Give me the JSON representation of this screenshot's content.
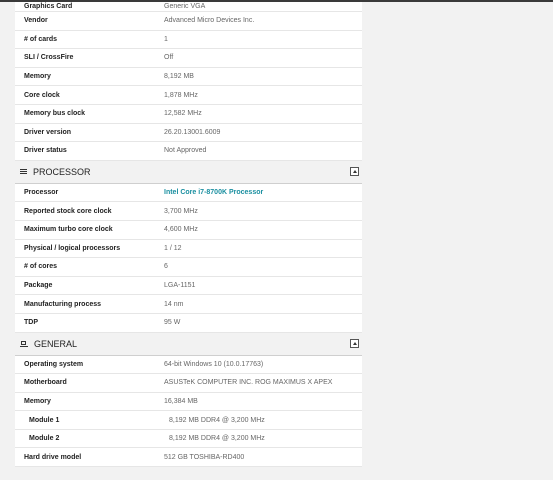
{
  "graphics": [
    {
      "label": "Graphics Card",
      "value": "Generic VGA"
    },
    {
      "label": "Vendor",
      "value": "Advanced Micro Devices Inc."
    },
    {
      "label": "# of cards",
      "value": "1"
    },
    {
      "label": "SLI / CrossFire",
      "value": "Off"
    },
    {
      "label": "Memory",
      "value": "8,192 MB"
    },
    {
      "label": "Core clock",
      "value": "1,878 MHz"
    },
    {
      "label": "Memory bus clock",
      "value": "12,582 MHz"
    },
    {
      "label": "Driver version",
      "value": "26.20.13001.6009"
    },
    {
      "label": "Driver status",
      "value": "Not Approved"
    }
  ],
  "processor": {
    "title": "PROCESSOR",
    "rows": [
      {
        "label": "Processor",
        "value": "Intel Core i7-8700K Processor"
      },
      {
        "label": "Reported stock core clock",
        "value": "3,700 MHz"
      },
      {
        "label": "Maximum turbo core clock",
        "value": "4,600 MHz"
      },
      {
        "label": "Physical / logical processors",
        "value": "1 / 12"
      },
      {
        "label": "# of cores",
        "value": "6"
      },
      {
        "label": "Package",
        "value": "LGA-1151"
      },
      {
        "label": "Manufacturing process",
        "value": "14 nm"
      },
      {
        "label": "TDP",
        "value": "95 W"
      }
    ]
  },
  "general": {
    "title": "GENERAL",
    "rows": [
      {
        "label": "Operating system",
        "value": "64-bit Windows 10 (10.0.17763)"
      },
      {
        "label": "Motherboard",
        "value": "ASUSTeK COMPUTER INC. ROG MAXIMUS X APEX"
      },
      {
        "label": "Memory",
        "value": "16,384 MB"
      },
      {
        "label": "Module 1",
        "value": "8,192 MB DDR4 @ 3,200 MHz"
      },
      {
        "label": "Module 2",
        "value": "8,192 MB DDR4 @ 3,200 MHz"
      },
      {
        "label": "Hard drive model",
        "value": "512 GB TOSHIBA-RD400"
      }
    ]
  }
}
